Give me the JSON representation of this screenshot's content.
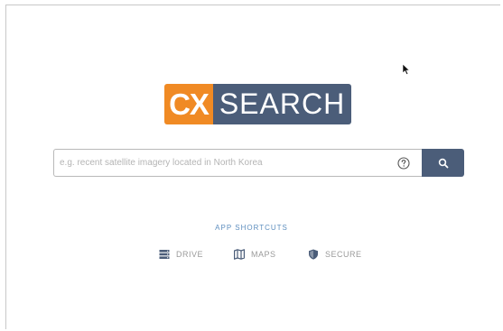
{
  "logo": {
    "left_text": "CX",
    "right_text": "SEARCH"
  },
  "search": {
    "placeholder": "e.g. recent satellite imagery located in North Korea",
    "help_icon": "help-circle-icon",
    "button_icon": "search-icon"
  },
  "shortcuts": {
    "heading": "APP SHORTCUTS",
    "items": [
      {
        "label": "DRIVE",
        "icon": "drive-icon"
      },
      {
        "label": "MAPS",
        "icon": "map-icon"
      },
      {
        "label": "SECURE",
        "icon": "shield-icon"
      }
    ]
  },
  "colors": {
    "brand_orange": "#f08a24",
    "brand_navy": "#4b5d79",
    "link_blue": "#5f8fbf"
  }
}
